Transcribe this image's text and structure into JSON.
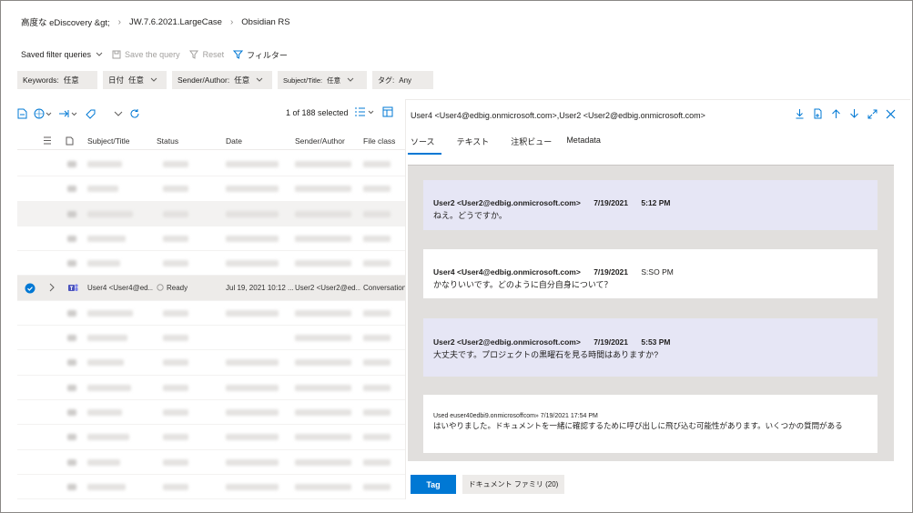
{
  "breadcrumb": [
    "高度な eDiscovery &gt;",
    "JW.7.6.2021.LargeCase",
    "Obsidian RS"
  ],
  "toolbar": {
    "saved_queries": "Saved filter queries",
    "save_query": "Save the query",
    "reset": "Reset",
    "filter": "フィルター"
  },
  "filters": [
    {
      "label": "Keywords:",
      "value": "任意"
    },
    {
      "label": "日付",
      "value": "任意"
    },
    {
      "label": "Sender/Author:",
      "value": "任意"
    },
    {
      "label": "Subject/Title:",
      "value": "任意"
    },
    {
      "label": "タグ:",
      "value": "Any"
    }
  ],
  "list": {
    "count_text": "1 of 188 selected",
    "columns": [
      "Subject/Title",
      "Status",
      "Date",
      "Sender/Author",
      "File class"
    ],
    "selected_row": {
      "subject": "User4 <User4@ed...",
      "status": "Ready",
      "date": "Jul 19, 2021 10:12 ...",
      "sender": "User2 <User2@ed...",
      "file_class": "Conversation"
    }
  },
  "detail": {
    "title": "User4 <User4@edbig.onmicrosoft.com>,User2 <User2@edbig.onmicrosoft.com>",
    "tabs": [
      "ソース",
      "テキスト",
      "注釈ビュー",
      "Metadata"
    ],
    "messages": [
      {
        "sender": "User2 <User2@edbig.onmicrosoft.com>",
        "date": "7/19/2021",
        "time": "5:12 PM",
        "text": "ねえ。どうですか。"
      },
      {
        "sender": "User4 <User4@edbig.onmicrosoft.com>",
        "date": "7/19/2021",
        "time": "S:SO PM",
        "text": "かなりいいです。どのように自分自身について？"
      },
      {
        "sender": "User2 <User2@edbig.onmicrosoft.com>",
        "date": "7/19/2021",
        "time": "5:53 PM",
        "text": "大丈夫です。プロジェクトの黒曜石を見る時間はありますか?"
      },
      {
        "sender": "Used euser40edbi9.onmicrosoffcom»",
        "date": "7/19/2021",
        "time": "17:54 PM",
        "text": "はいやりました。ドキュメントを一緒に確認するために呼び出しに飛び込む可能性があります。いくつかの質問がある"
      }
    ],
    "tag_button": "Tag",
    "family_button": "ドキュメント ファミリ (20)"
  },
  "colors": {
    "accent": "#0078d4",
    "tint": "#e6e6f5",
    "pill": "#edebe9"
  }
}
